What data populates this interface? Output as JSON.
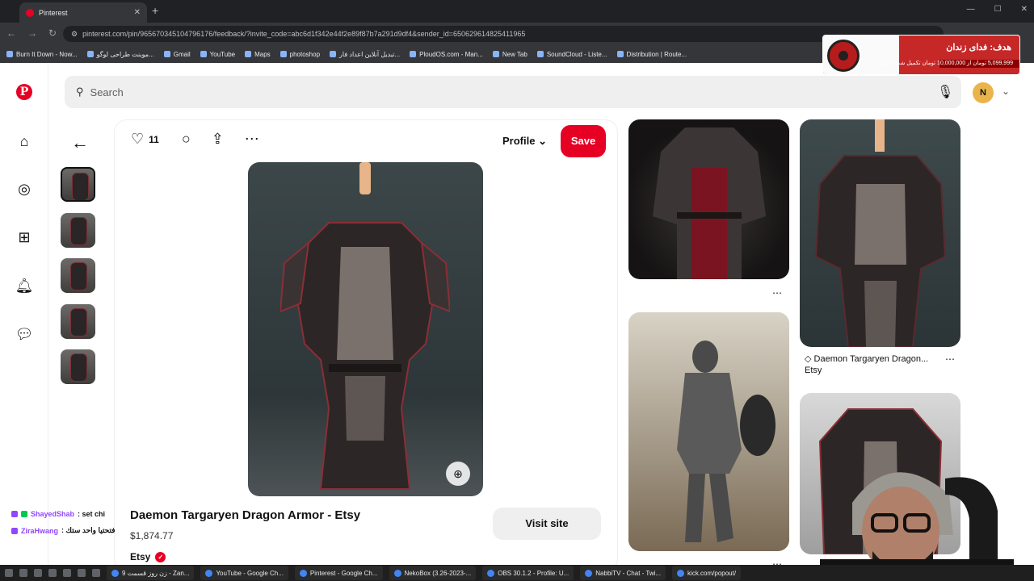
{
  "browser": {
    "tab_title": "Pinterest",
    "url": "pinterest.com/pin/965670345104796176/feedback/?invite_code=abc6d1f342e44f2e89f87b7a291d9df4&sender_id=650629614825411965",
    "bookmarks": [
      "Burn It Down - Now...",
      "موبنت طراحی لوگو...",
      "Gmail",
      "YouTube",
      "Maps",
      "photoshop",
      "تبدیل آنلاین اعداد فار...",
      "PloudOS.com - Man...",
      "New Tab",
      "SoundCloud - Liste...",
      "Distribution | Route..."
    ]
  },
  "ad": {
    "title": "هدف: فدای زندان",
    "sub": "5,099,999 تومان از 10,000,000 تومان تکمیل شده است.",
    "progress_fraction": 0.51
  },
  "search": {
    "placeholder": "Search"
  },
  "user": {
    "initial": "N"
  },
  "pin": {
    "like_count": "11",
    "profile_label": "Profile",
    "save_label": "Save",
    "title": "Daemon Targaryen Dragon Armor - Etsy",
    "price": "$1,874.77",
    "store": "Etsy",
    "visit_label": "Visit site"
  },
  "related": {
    "pin2_title": "Daemon Targaryen Dragon...",
    "pin2_source": "Etsy"
  },
  "chat": [
    {
      "name": "ShayedShab",
      "msg": ": set chi"
    },
    {
      "name": "ZiraHwang",
      "msg": ": فتحتيا واحد ستك"
    }
  ],
  "taskbar": [
    "زن روز قسمت 9 - Zan...",
    "YouTube - Google Ch...",
    "Pinterest - Google Ch...",
    "NekoBox (3.26-2023-...",
    "OBS 30.1.2 - Profile: U...",
    "NabbiTV - Chat - Twi...",
    "kick.com/popout/"
  ],
  "colors": {
    "brand": "#e60023",
    "chrome_dark": "#202124"
  }
}
